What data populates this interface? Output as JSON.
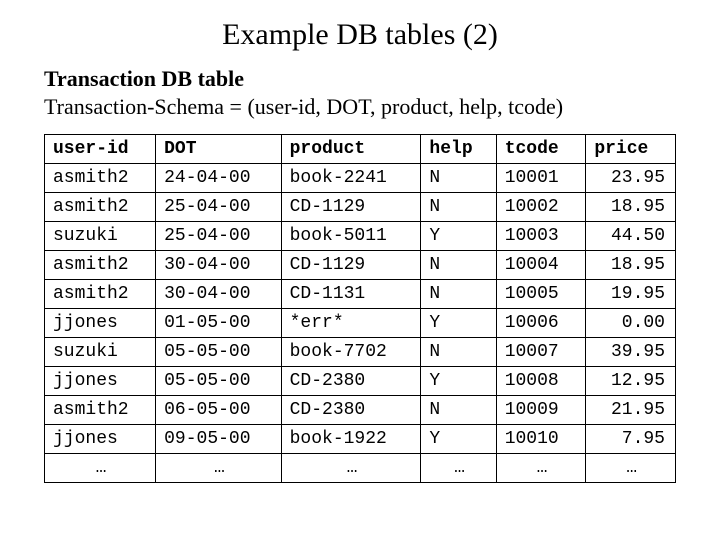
{
  "title": "Example DB tables (2)",
  "subtitle": "Transaction DB table",
  "schema": "Transaction-Schema = (user-id, DOT, product, help, tcode)",
  "chart_data": {
    "type": "table",
    "columns": [
      "user-id",
      "DOT",
      "product",
      "help",
      "tcode",
      "price"
    ],
    "rows": [
      [
        "asmith2",
        "24-04-00",
        "book-2241",
        "N",
        "10001",
        "23.95"
      ],
      [
        "asmith2",
        "25-04-00",
        "CD-1129",
        "N",
        "10002",
        "18.95"
      ],
      [
        "suzuki",
        "25-04-00",
        "book-5011",
        "Y",
        "10003",
        "44.50"
      ],
      [
        "asmith2",
        "30-04-00",
        "CD-1129",
        "N",
        "10004",
        "18.95"
      ],
      [
        "asmith2",
        "30-04-00",
        "CD-1131",
        "N",
        "10005",
        "19.95"
      ],
      [
        "jjones",
        "01-05-00",
        "*err*",
        "Y",
        "10006",
        "0.00"
      ],
      [
        "suzuki",
        "05-05-00",
        "book-7702",
        "N",
        "10007",
        "39.95"
      ],
      [
        "jjones",
        "05-05-00",
        "CD-2380",
        "Y",
        "10008",
        "12.95"
      ],
      [
        "asmith2",
        "06-05-00",
        "CD-2380",
        "N",
        "10009",
        "21.95"
      ],
      [
        "jjones",
        "09-05-00",
        "book-1922",
        "Y",
        "10010",
        "7.95"
      ]
    ],
    "ellipsis_row": [
      "…",
      "…",
      "…",
      "…",
      "…",
      "…"
    ]
  }
}
